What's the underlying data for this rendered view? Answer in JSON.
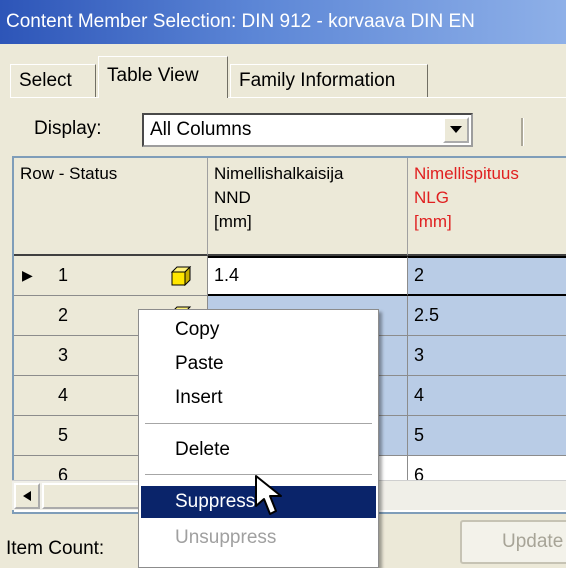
{
  "window": {
    "title": "Content Member Selection:  DIN 912  - korvaava DIN EN"
  },
  "tabs": [
    {
      "label": "Select"
    },
    {
      "label": "Table View"
    },
    {
      "label": "Family Information"
    }
  ],
  "display": {
    "label": "Display:",
    "value": "All Columns"
  },
  "table": {
    "headers": {
      "status": "Row - Status",
      "col1": [
        "Nimellishalkaisija",
        "NND",
        "[mm]"
      ],
      "col2": [
        "Nimellispituus",
        "NLG",
        "[mm]"
      ]
    },
    "colors": {
      "header_highlight": "#e02020",
      "row_highlight": "#b9cce6"
    },
    "rows": [
      {
        "num": "1",
        "nnd": "1.4",
        "nlg": "2"
      },
      {
        "num": "2",
        "nnd": "",
        "nlg": "2.5"
      },
      {
        "num": "3",
        "nnd": "",
        "nlg": "3"
      },
      {
        "num": "4",
        "nnd": "",
        "nlg": "4"
      },
      {
        "num": "5",
        "nnd": "",
        "nlg": "5"
      },
      {
        "num": "6",
        "nnd": "",
        "nlg": "6"
      }
    ]
  },
  "context_menu": {
    "items": [
      {
        "label": "Copy",
        "state": "normal"
      },
      {
        "label": "Paste",
        "state": "normal"
      },
      {
        "label": "Insert",
        "state": "normal"
      },
      {
        "label": "Delete",
        "state": "normal"
      },
      {
        "label": "Suppress",
        "state": "highlighted"
      },
      {
        "label": "Unsuppress",
        "state": "disabled"
      }
    ],
    "highlight_color": "#0a246a"
  },
  "footer": {
    "item_count_label": "Item Count:",
    "update_label": "Update"
  },
  "accent": {
    "titlebar_start": "#2d55b8",
    "titlebar_end": "#8eb0e8"
  }
}
